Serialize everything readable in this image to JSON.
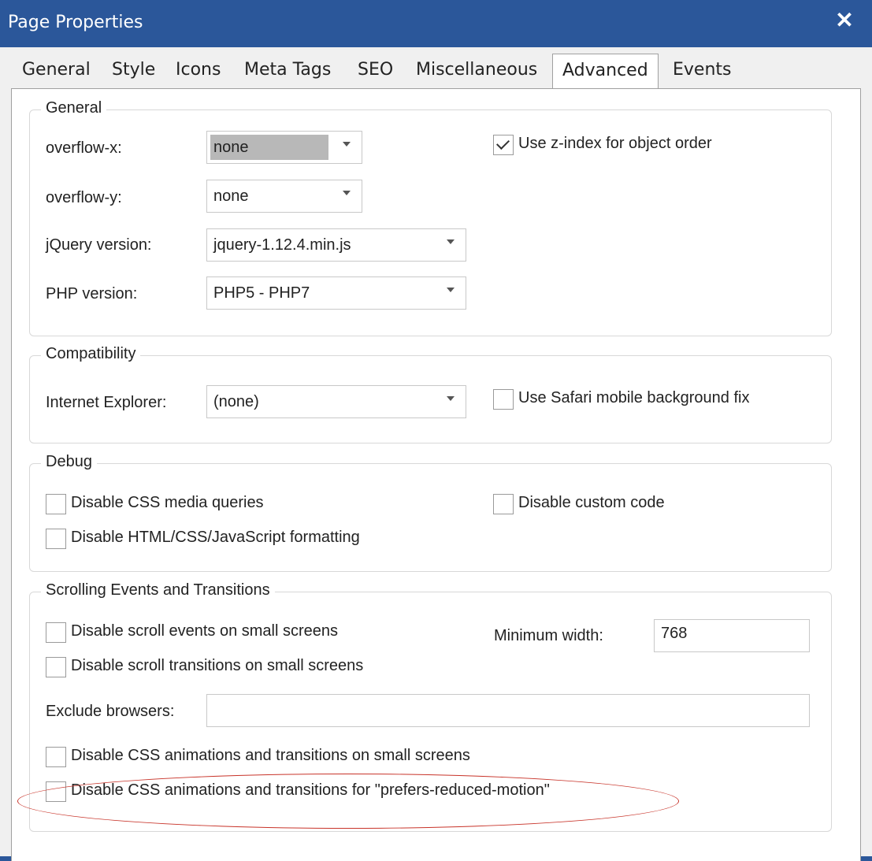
{
  "window": {
    "title": "Page Properties",
    "close_label": "✕"
  },
  "tabs": [
    {
      "label": "General"
    },
    {
      "label": "Style"
    },
    {
      "label": "Icons"
    },
    {
      "label": "Meta Tags"
    },
    {
      "label": "SEO"
    },
    {
      "label": "Miscellaneous"
    },
    {
      "label": "Advanced",
      "active": true
    },
    {
      "label": "Events"
    }
  ],
  "general": {
    "legend": "General",
    "overflow_x": {
      "label": "overflow-x:",
      "value": "none"
    },
    "overflow_y": {
      "label": "overflow-y:",
      "value": "none"
    },
    "jquery": {
      "label": "jQuery version:",
      "value": "jquery-1.12.4.min.js"
    },
    "php": {
      "label": "PHP version:",
      "value": "PHP5 - PHP7"
    },
    "zindex": {
      "label": "Use z-index for object order",
      "checked": true
    }
  },
  "compatibility": {
    "legend": "Compatibility",
    "ie": {
      "label": "Internet Explorer:",
      "value": "(none)"
    },
    "safari": {
      "label": "Use Safari mobile background fix",
      "checked": false
    }
  },
  "debug": {
    "legend": "Debug",
    "media_queries": {
      "label": "Disable CSS media queries",
      "checked": false
    },
    "custom_code": {
      "label": "Disable custom code",
      "checked": false
    },
    "formatting": {
      "label": "Disable HTML/CSS/JavaScript formatting",
      "checked": false
    }
  },
  "scrolling": {
    "legend": "Scrolling Events and Transitions",
    "scroll_events": {
      "label": "Disable scroll events on small screens",
      "checked": false
    },
    "scroll_transitions": {
      "label": "Disable scroll transitions on small screens",
      "checked": false
    },
    "min_width": {
      "label": "Minimum width:",
      "value": "768"
    },
    "exclude": {
      "label": "Exclude browsers:",
      "value": ""
    },
    "css_anim_small": {
      "label": "Disable CSS animations and transitions on small screens",
      "checked": false
    },
    "css_anim_reduced": {
      "label": "Disable CSS animations and transitions for \"prefers-reduced-motion\"",
      "checked": false
    }
  },
  "colors": {
    "titlebar": "#2b579a",
    "highlight_ellipse": "#c8342a"
  }
}
